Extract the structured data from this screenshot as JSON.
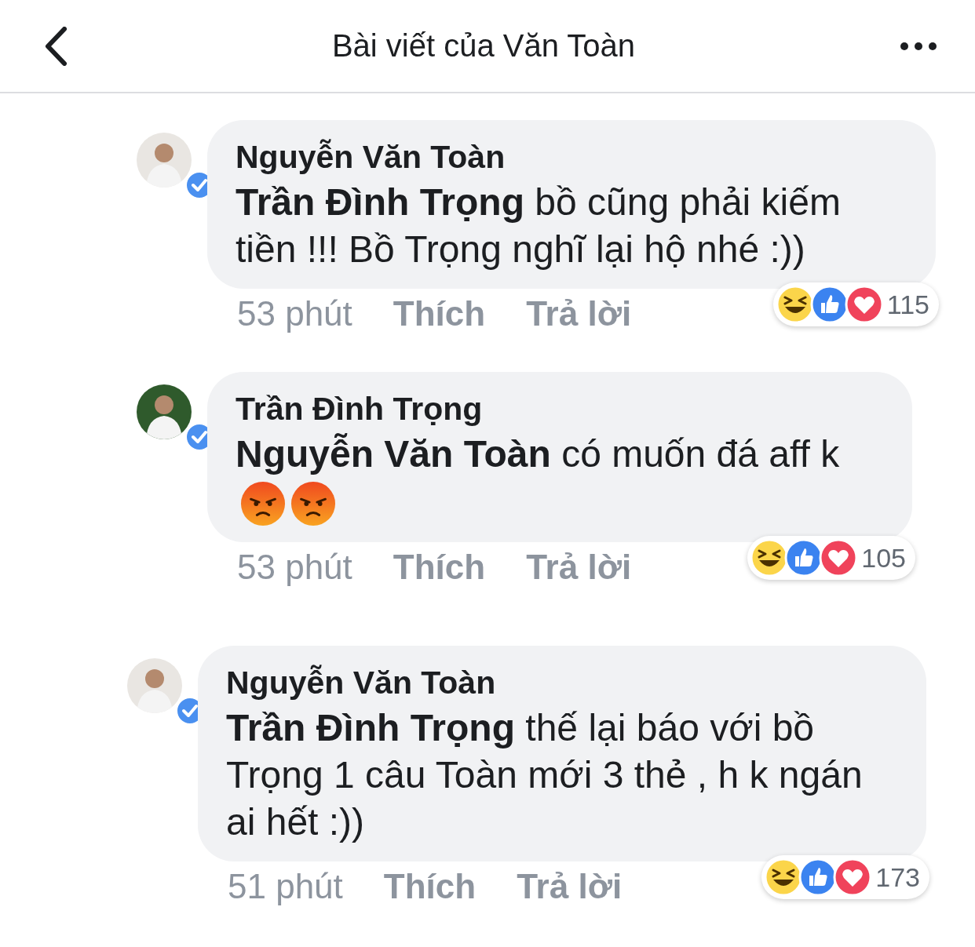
{
  "header": {
    "title": "Bài viết của Văn Toàn"
  },
  "comments": [
    {
      "author": "Nguyễn Văn Toàn",
      "verified": true,
      "text": "**Trần Đình Trọng** bồ cũng phải kiếm tiền !!! Bồ Trọng nghĩ lại hộ nhé :))",
      "time": "53 phút",
      "actions": [
        "Thích",
        "Trả lời"
      ],
      "reactions": [
        {
          "kind": "haha"
        },
        {
          "kind": "like"
        },
        {
          "kind": "love"
        }
      ],
      "reaction_count": "115"
    },
    {
      "author": "Trần Đình Trọng",
      "verified": true,
      "text": "**Nguyễn Văn Toàn**  có muốn đá aff k",
      "emojis": [
        {
          "kind": "angry"
        },
        {
          "kind": "angry"
        }
      ],
      "time": "53 phút",
      "actions": [
        "Thích",
        "Trả lời"
      ],
      "reactions": [
        {
          "kind": "haha"
        },
        {
          "kind": "like"
        },
        {
          "kind": "love"
        }
      ],
      "reaction_count": "105"
    },
    {
      "author": "Nguyễn Văn Toàn",
      "verified": true,
      "text": "**Trần Đình Trọng** thế lại báo với bồ Trọng 1 câu Toàn mới 3 thẻ , h k ngán ai hết :))",
      "time": "51 phút",
      "actions": [
        "Thích",
        "Trả lời"
      ],
      "reactions": [
        {
          "kind": "haha"
        },
        {
          "kind": "like"
        },
        {
          "kind": "love"
        }
      ],
      "reaction_count": "173"
    }
  ]
}
